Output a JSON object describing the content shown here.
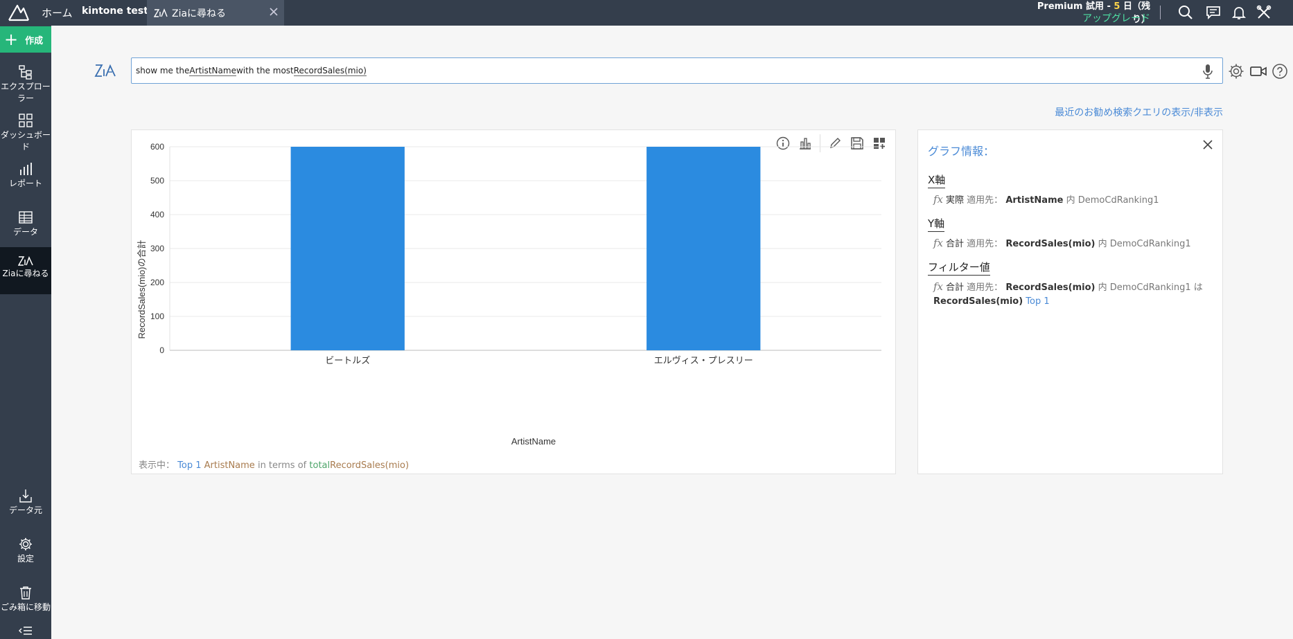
{
  "topbar": {
    "home_label": "ホーム",
    "workspace_label": "kintone test",
    "tab_label": "Ziaに尋ねる",
    "trial_prefix": "Premium 試用 - ",
    "trial_days": "5",
    "trial_suffix": " 日（残り）",
    "upgrade_label": "アップグレード",
    "icons": [
      "search-icon",
      "comments-icon",
      "bell-icon",
      "tools-icon"
    ]
  },
  "sidebar": {
    "create_label": "作成",
    "items": [
      {
        "label": "エクスプローラー",
        "icon": "explorer-icon"
      },
      {
        "label": "ダッシュボード",
        "icon": "dashboard-icon"
      },
      {
        "label": "レポート",
        "icon": "report-icon"
      },
      {
        "label": "データ",
        "icon": "table-icon"
      },
      {
        "label": "Ziaに尋ねる",
        "icon": "zia-icon",
        "active": true
      },
      {
        "label": "データ元",
        "icon": "datasource-icon"
      },
      {
        "label": "設定",
        "icon": "gear-icon"
      },
      {
        "label": "ごみ箱に移動",
        "icon": "trash-icon"
      }
    ]
  },
  "search": {
    "parts": [
      "show me the ",
      "ArtistName",
      " with the most ",
      "RecordSales(mio)"
    ]
  },
  "recent_queries_link": "最近のお勧め検索クエリの表示/非表示",
  "chart_data": {
    "type": "bar",
    "categories": [
      "ビートルズ",
      "エルヴィス・プレスリー"
    ],
    "values": [
      600,
      600
    ],
    "xlabel": "ArtistName",
    "ylabel": "RecordSales(mio)の合計",
    "ylim": [
      0,
      600
    ],
    "yticks": [
      0,
      100,
      200,
      300,
      400,
      500,
      600
    ],
    "grid": true,
    "bar_color": "#2b8be0"
  },
  "chart_footer": {
    "prefix": "表示中：",
    "top": "Top 1",
    "field": "ArtistName",
    "mid": "in terms of",
    "agg": "total",
    "measure": "RecordSales(mio)"
  },
  "info": {
    "title": "グラフ情報：",
    "x_title": "X軸",
    "x_func": "実際",
    "x_apply": "適用先：",
    "x_field": "ArtistName",
    "x_in": "内",
    "x_table": "DemoCdRanking1",
    "y_title": "Y軸",
    "y_func": "合計",
    "y_apply": "適用先：",
    "y_field": "RecordSales(mio)",
    "y_in": "内",
    "y_table": "DemoCdRanking1",
    "f_title": "フィルター値",
    "f_func": "合計",
    "f_apply": "適用先：",
    "f_field": "RecordSales(mio)",
    "f_in": "内",
    "f_table": "DemoCdRanking1",
    "f_ha": "は",
    "f_field2": "RecordSales(mio)",
    "f_top": "Top 1"
  }
}
